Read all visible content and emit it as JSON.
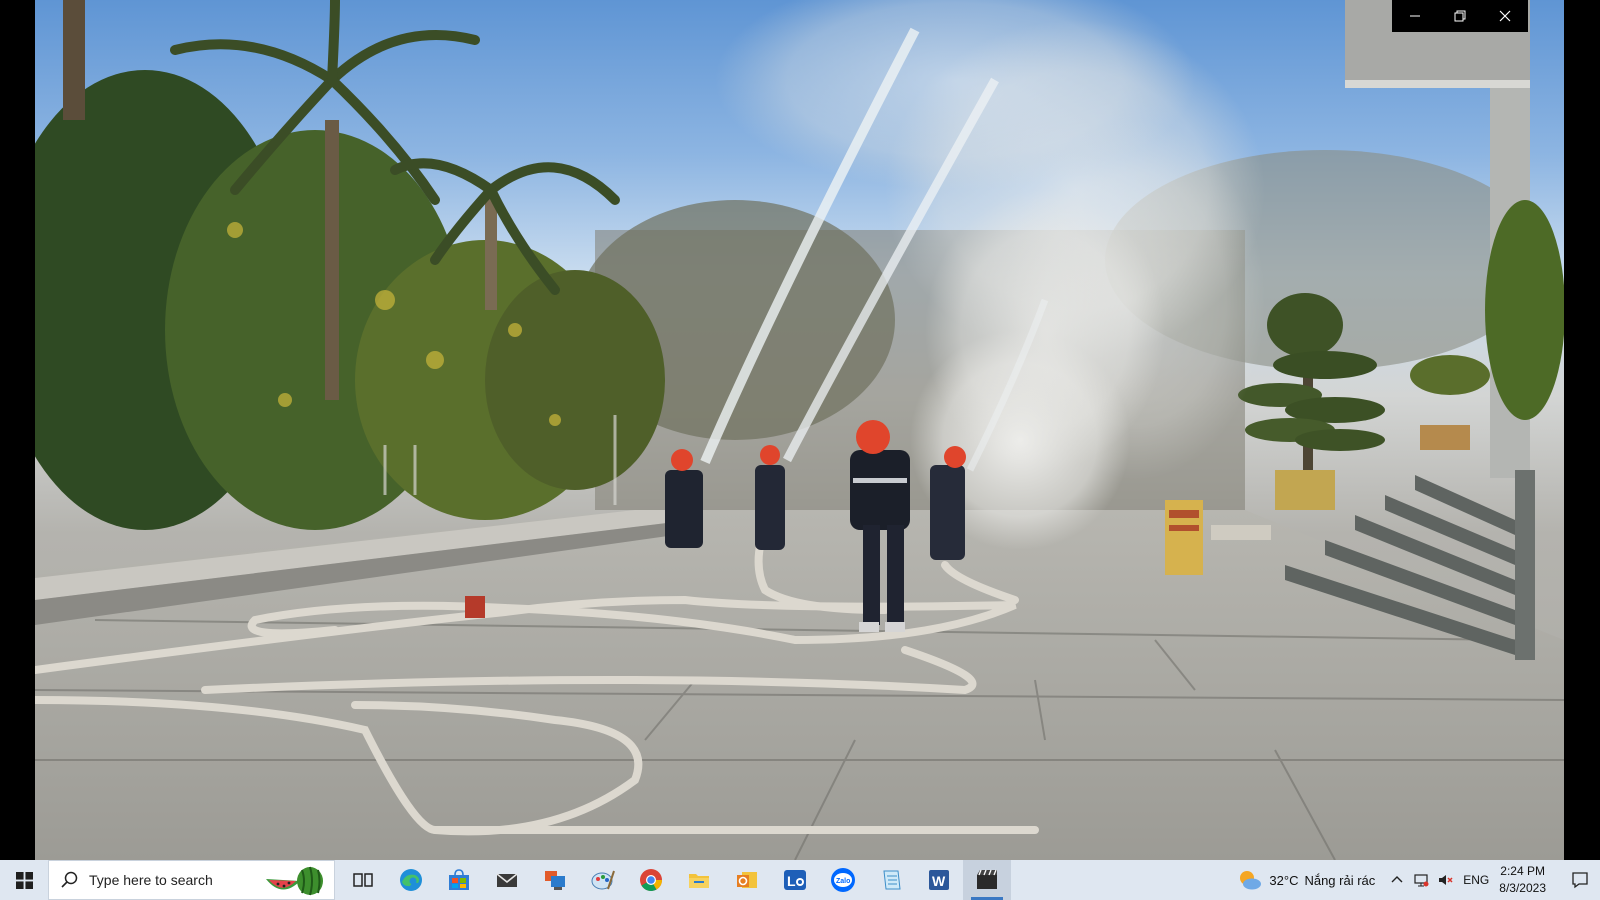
{
  "window": {
    "minimize_icon": "minimize-icon",
    "restore_icon": "restore-icon",
    "close_icon": "close-icon"
  },
  "taskbar": {
    "search_placeholder": "Type here to search",
    "apps": [
      {
        "name": "task-view-icon"
      },
      {
        "name": "edge-icon"
      },
      {
        "name": "store-icon"
      },
      {
        "name": "mail-icon"
      },
      {
        "name": "remote-desktop-icon"
      },
      {
        "name": "paint-icon"
      },
      {
        "name": "chrome-icon"
      },
      {
        "name": "file-explorer-icon"
      },
      {
        "name": "outlook-icon"
      },
      {
        "name": "lifesize-icon"
      },
      {
        "name": "zalo-icon",
        "label": "Zalo"
      },
      {
        "name": "notepad-icon"
      },
      {
        "name": "word-icon",
        "label": "W"
      },
      {
        "name": "video-editor-icon",
        "active": true
      }
    ],
    "tray": {
      "temperature": "32°C",
      "weather_text": "Nắng rải rác",
      "language": "ENG",
      "time": "2:24 PM",
      "date": "8/3/2023"
    }
  },
  "colors": {
    "taskbar_bg": "#dfe7f1",
    "accent": "#3a78c3",
    "helmet": "#e0452c"
  }
}
